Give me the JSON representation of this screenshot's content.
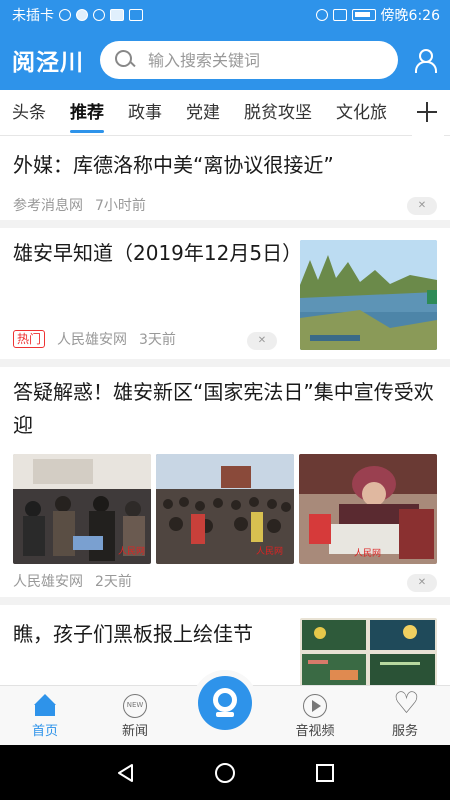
{
  "status_bar": {
    "carrier": "未插卡",
    "time": "傍晚6:26"
  },
  "header": {
    "logo": "阅泾川",
    "search_placeholder": "输入搜索关键词"
  },
  "tabs": [
    "头条",
    "推荐",
    "政事",
    "党建",
    "脱贫攻坚",
    "文化旅"
  ],
  "active_tab": "推荐",
  "feed": [
    {
      "title": "外媒：库德洛称中美“离协议很接近”",
      "source": "参考消息网",
      "time": "7小时前"
    },
    {
      "title": "雄安早知道（2019年12月5日）",
      "hot_label": "热门",
      "source": "人民雄安网",
      "time": "3天前"
    },
    {
      "title": "答疑解惑！雄安新区“国家宪法日”集中宣传受欢迎",
      "source": "人民雄安网",
      "time": "2天前"
    },
    {
      "title": "瞧，孩子们黑板报上绘佳节"
    }
  ],
  "bottom_nav": {
    "home": "首页",
    "news": "新闻",
    "news_badge": "NEW",
    "video": "音视频",
    "service": "服务"
  },
  "colors": {
    "accent": "#2e93ea",
    "hot": "#e33333"
  }
}
